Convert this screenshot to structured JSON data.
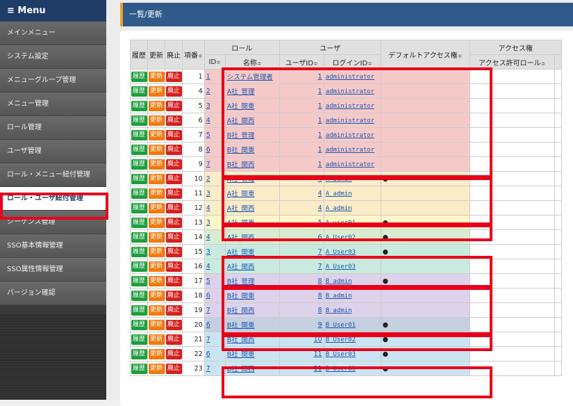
{
  "sidebar": {
    "header": "≡ Menu",
    "items": [
      {
        "label": "メインメニュー"
      },
      {
        "label": "システム設定"
      },
      {
        "label": "メニューグループ管理"
      },
      {
        "label": "メニュー管理"
      },
      {
        "label": "ロール管理"
      },
      {
        "label": "ユーザ管理"
      },
      {
        "label": "ロール・メニュー紐付管理"
      },
      {
        "label": "ロール・ユーザ紐付管理",
        "active": true
      },
      {
        "label": "シーケンス管理"
      },
      {
        "label": "SSO基本情報管理"
      },
      {
        "label": "SSO属性情報管理"
      },
      {
        "label": "バージョン確認"
      }
    ]
  },
  "page": {
    "title": "一覧/更新"
  },
  "table": {
    "headers": {
      "history": "履歴",
      "update": "更新",
      "discard": "廃止",
      "item_no": "項番",
      "role_group": "ロール",
      "user_group": "ユーザ",
      "default_access": "デフォルトアクセス権",
      "access_group": "アクセス権",
      "role_id": "ID",
      "role_name": "名称",
      "user_id": "ユーザID",
      "login_id": "ログインID",
      "access_allowed_role": "アクセス許可ロール"
    },
    "buttons": {
      "history": "履歴",
      "update": "更新",
      "discard": "廃止"
    },
    "sort_glyph": "≑",
    "row_colors": [
      "#f6c9c9",
      "#fbecc8",
      "#fdf6c6",
      "#d8ecd0",
      "#c9ebdf",
      "#ddd2ea",
      "#c4cfe0",
      "#cbe4f2"
    ],
    "rows": [
      {
        "no": "1",
        "role_id": "1",
        "role_name": "システム管理者",
        "user_id": "1",
        "login_id": "administrator",
        "default": "",
        "band": 0
      },
      {
        "no": "4",
        "role_id": "2",
        "role_name": "A社_管理",
        "user_id": "1",
        "login_id": "administrator",
        "default": "",
        "band": 0
      },
      {
        "no": "5",
        "role_id": "3",
        "role_name": "A社_関東",
        "user_id": "1",
        "login_id": "administrator",
        "default": "",
        "band": 0
      },
      {
        "no": "6",
        "role_id": "4",
        "role_name": "A社_関西",
        "user_id": "1",
        "login_id": "administrator",
        "default": "",
        "band": 0
      },
      {
        "no": "7",
        "role_id": "5",
        "role_name": "B社_管理",
        "user_id": "1",
        "login_id": "administrator",
        "default": "",
        "band": 0
      },
      {
        "no": "8",
        "role_id": "6",
        "role_name": "B社_関東",
        "user_id": "1",
        "login_id": "administrator",
        "default": "",
        "band": 0
      },
      {
        "no": "9",
        "role_id": "7",
        "role_name": "B社_関西",
        "user_id": "1",
        "login_id": "administrator",
        "default": "",
        "band": 0
      },
      {
        "no": "10",
        "role_id": "2",
        "role_name": "A社_管理",
        "user_id": "4",
        "login_id": "A_admin",
        "default": "●",
        "band": 1
      },
      {
        "no": "11",
        "role_id": "3",
        "role_name": "A社_関東",
        "user_id": "4",
        "login_id": "A_admin",
        "default": "",
        "band": 1
      },
      {
        "no": "12",
        "role_id": "4",
        "role_name": "A社_関西",
        "user_id": "4",
        "login_id": "A_admin",
        "default": "",
        "band": 1
      },
      {
        "no": "13",
        "role_id": "3",
        "role_name": "A社_関東",
        "user_id": "5",
        "login_id": "A_user01",
        "default": "●",
        "band": 2
      },
      {
        "no": "14",
        "role_id": "4",
        "role_name": "A社_関西",
        "user_id": "6",
        "login_id": "A_User02",
        "default": "●",
        "band": 3
      },
      {
        "no": "15",
        "role_id": "3",
        "role_name": "A社_関東",
        "user_id": "7",
        "login_id": "A_User03",
        "default": "●",
        "band": 4
      },
      {
        "no": "16",
        "role_id": "4",
        "role_name": "A社_関西",
        "user_id": "7",
        "login_id": "A_User03",
        "default": "",
        "band": 4
      },
      {
        "no": "17",
        "role_id": "5",
        "role_name": "B社_管理",
        "user_id": "8",
        "login_id": "B_admin",
        "default": "●",
        "band": 5
      },
      {
        "no": "18",
        "role_id": "6",
        "role_name": "B社_関東",
        "user_id": "8",
        "login_id": "B_admin",
        "default": "",
        "band": 5
      },
      {
        "no": "19",
        "role_id": "7",
        "role_name": "B社_関西",
        "user_id": "8",
        "login_id": "B_admin",
        "default": "",
        "band": 5
      },
      {
        "no": "20",
        "role_id": "6",
        "role_name": "B社_関東",
        "user_id": "9",
        "login_id": "B_User01",
        "default": "●",
        "band": 6
      },
      {
        "no": "21",
        "role_id": "7",
        "role_name": "B社_関西",
        "user_id": "10",
        "login_id": "B_User02",
        "default": "●",
        "band": 7
      },
      {
        "no": "22",
        "role_id": "6",
        "role_name": "B社_関東",
        "user_id": "11",
        "login_id": "B_User03",
        "default": "●",
        "band": 7
      },
      {
        "no": "23",
        "role_id": "7",
        "role_name": "B社_関西",
        "user_id": "11",
        "login_id": "B_User03",
        "default": "●",
        "band": 7
      }
    ]
  }
}
